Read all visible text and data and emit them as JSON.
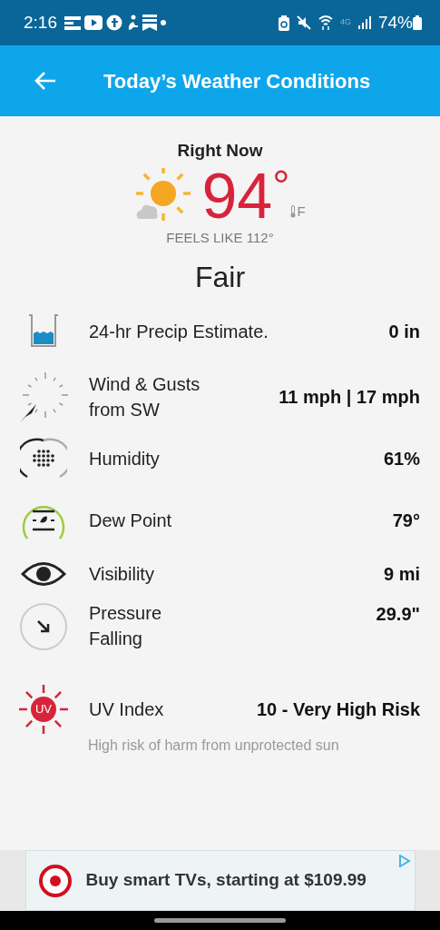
{
  "status_bar": {
    "time": "2:16",
    "network": "4G",
    "battery": "74%"
  },
  "header": {
    "title": "Today’s Weather Conditions"
  },
  "current": {
    "heading": "Right Now",
    "temperature": "94",
    "degree": "°",
    "unit": "F",
    "feels_like": "FEELS LIKE 112°",
    "condition": "Fair"
  },
  "conditions": [
    {
      "kind": "precip",
      "label": "24-hr Precip Estimate.",
      "value": "0 in"
    },
    {
      "kind": "wind",
      "label": "Wind & Gusts\nfrom SW",
      "value": "11 mph | 17 mph"
    },
    {
      "kind": "humidity",
      "label": "Humidity",
      "value": "61%"
    },
    {
      "kind": "dew",
      "label": "Dew Point",
      "value": "79°"
    },
    {
      "kind": "visibility",
      "label": "Visibility",
      "value": "9 mi"
    },
    {
      "kind": "pressure",
      "label": "Pressure\nFalling",
      "value": "29.9\""
    },
    {
      "kind": "uv",
      "label": "UV Index",
      "value": "10 - Very High Risk",
      "icon_text": "UV",
      "note": "High risk of harm from unprotected sun"
    }
  ],
  "ad": {
    "text": "Buy smart TVs, starting at $109.99"
  }
}
